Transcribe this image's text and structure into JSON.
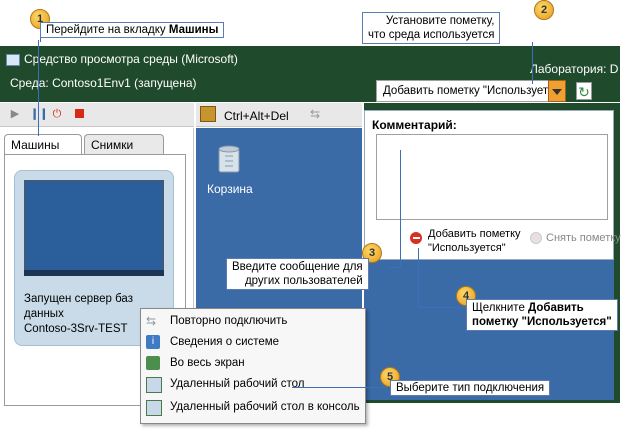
{
  "callouts": {
    "c1": {
      "num": "1",
      "text_pre": "Перейдите на вкладку ",
      "text_bold": "Машины"
    },
    "c2": {
      "num": "2",
      "line1": "Установите пометку,",
      "line2": "что среда используется"
    },
    "c3": {
      "num": "3",
      "line1": "Введите сообщение для",
      "line2": "других пользователей"
    },
    "c4": {
      "num": "4",
      "text_pre": "Щелкните ",
      "bold1": "Добавить",
      "bold2": "пометку \"Используется\""
    },
    "c5": {
      "num": "5",
      "text": "Выберите тип подключения"
    }
  },
  "header": {
    "title": "Средство просмотра среды (Microsoft)",
    "environment": "Среда: Contoso1Env1 (запущена)",
    "lab": "Лаборатория: D"
  },
  "toolbar": {
    "ctrl_alt_del": "Ctrl+Alt+Del"
  },
  "tabs": [
    {
      "label": "Машины",
      "active": true
    },
    {
      "label": "Снимки",
      "active": false
    }
  ],
  "vm": {
    "line1": "Запущен сервер баз",
    "line2": "данных",
    "line3": "Contoso-3Srv-TEST"
  },
  "desktop": {
    "recycle_label": "Корзина"
  },
  "context_menu": [
    {
      "label": "Повторно подключить",
      "icon": "reconnect-icon"
    },
    {
      "label": "Сведения о системе",
      "icon": "system-info-icon"
    },
    {
      "label": "Во весь экран",
      "icon": "fullscreen-icon"
    },
    {
      "label": "Удаленный рабочий стол",
      "icon": "remote-desktop-icon"
    },
    {
      "label": "Удаленный рабочий стол в консоль",
      "icon": "remote-desktop-console-icon"
    }
  ],
  "mark_panel": {
    "dropdown_value": "Добавить пометку \"Используется\"",
    "comment_label": "Комментарий:",
    "add_mark_line1": "Добавить пометку",
    "add_mark_line2": "\"Используется\"",
    "clear_mark": "Снять пометку"
  },
  "colors": {
    "header_green": "#1f4a2c",
    "desktop_blue": "#3a6ba6",
    "callout_border": "#5a7cb0",
    "badge_orange": "#e39c1a"
  }
}
